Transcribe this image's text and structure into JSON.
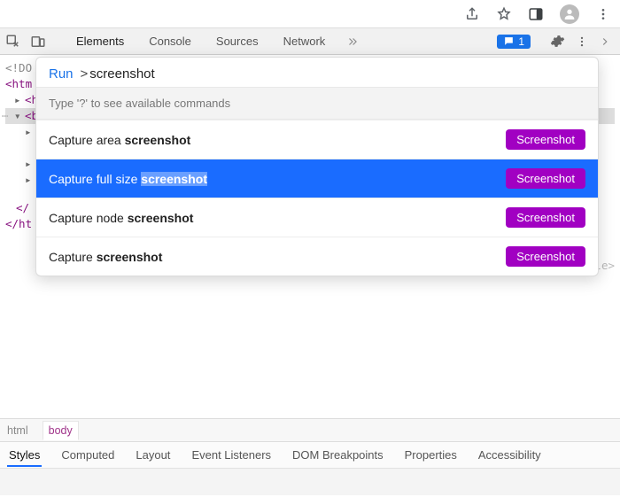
{
  "toolbar": {
    "issues_count": "1"
  },
  "tabs": {
    "elements": "Elements",
    "console": "Console",
    "sources": "Sources",
    "network": "Network"
  },
  "dom": {
    "doctype": "<!DO",
    "html_open": "<htm",
    "head": "<h",
    "body_sel": "<b",
    "child1": "",
    "child2": "",
    "body_close_a": "</",
    "html_close": "</ht",
    "inline_fragment": "le>"
  },
  "cmd": {
    "run": "Run",
    "prefix": ">",
    "query": "screenshot",
    "hint": "Type '?' to see available commands",
    "badge": "Screenshot",
    "items": [
      {
        "pre": "Capture area ",
        "match": "screenshot",
        "selected": false
      },
      {
        "pre": "Capture full size ",
        "match": "screenshot",
        "selected": true
      },
      {
        "pre": "Capture node ",
        "match": "screenshot",
        "selected": false
      },
      {
        "pre": "Capture ",
        "match": "screenshot",
        "selected": false
      }
    ]
  },
  "crumbs": {
    "html": "html",
    "body": "body"
  },
  "styles_tabs": {
    "styles": "Styles",
    "computed": "Computed",
    "layout": "Layout",
    "listeners": "Event Listeners",
    "dom_breakpoints": "DOM Breakpoints",
    "properties": "Properties",
    "accessibility": "Accessibility"
  }
}
